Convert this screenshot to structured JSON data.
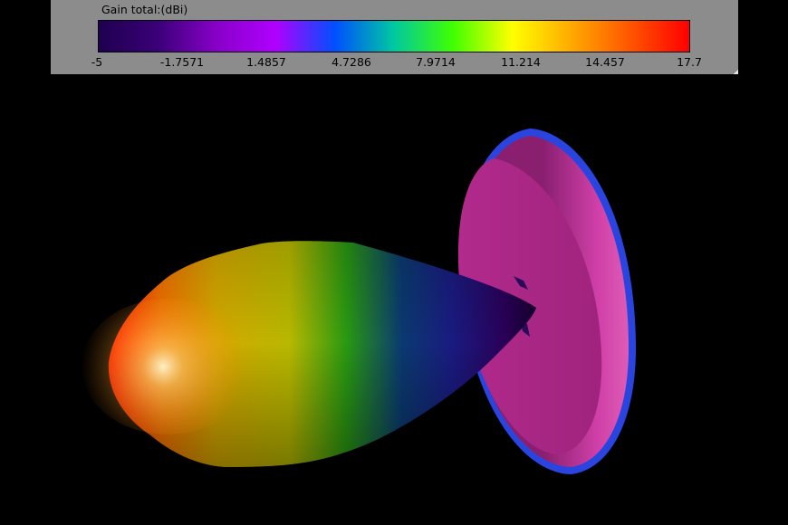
{
  "legend": {
    "title": "Gain total:(dBi)",
    "ticks": [
      "-5",
      "-1.7571",
      "1.4857",
      "4.7286",
      "7.9714",
      "11.214",
      "14.457",
      "17.7"
    ],
    "colors": [
      "#1e0050",
      "#3a0078",
      "#8800c8",
      "#b000ff",
      "#0050ff",
      "#00c8a0",
      "#40ff00",
      "#ffff00",
      "#ffaa00",
      "#ff5500",
      "#ff0000"
    ]
  },
  "scene": {
    "reflector_color": "#b02a8a",
    "reflector_rim_color": "#2040e0",
    "pattern_colors": [
      "#ff2000",
      "#f0a000",
      "#c8c800",
      "#30a000",
      "#0a2a80",
      "#3a0060"
    ]
  }
}
